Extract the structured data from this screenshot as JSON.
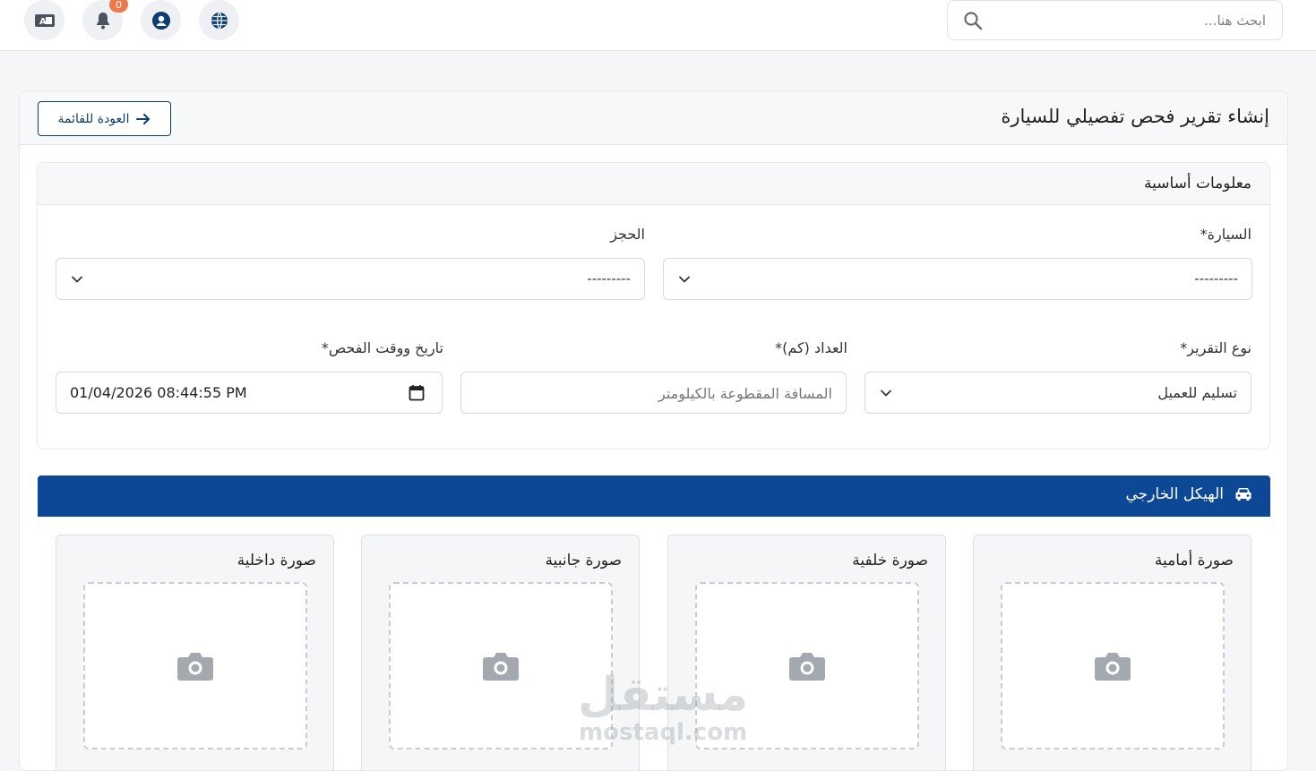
{
  "topbar": {
    "search_placeholder": "ابحث هنا...",
    "notification_count": "0"
  },
  "header": {
    "title": "إنشاء تقرير فحص تفصيلي للسيارة",
    "back_label": "العودة للقائمة"
  },
  "basic_info": {
    "title": "معلومات أساسية",
    "car_label": "السيارة*",
    "car_value": "---------",
    "booking_label": "الحجز",
    "booking_value": "---------",
    "report_type_label": "نوع التقرير*",
    "report_type_value": "تسليم للعميل",
    "odometer_label": "العداد (كم)*",
    "odometer_placeholder": "المسافة المقطوعة بالكيلومتر",
    "datetime_label": "تاريخ ووقت الفحص*",
    "datetime_value": "01/04/2026 08:44:55 PM"
  },
  "exterior": {
    "title": "الهيكل الخارجي",
    "photos": [
      {
        "label": "صورة أمامية"
      },
      {
        "label": "صورة خلفية"
      },
      {
        "label": "صورة جانبية"
      },
      {
        "label": "صورة داخلية"
      }
    ]
  },
  "watermark": {
    "line1": "مستقل",
    "line2": "mostaql.com"
  },
  "colors": {
    "primary": "#0c4896",
    "dark_blue": "#0c3d6e",
    "badge": "#ec7a4c"
  }
}
